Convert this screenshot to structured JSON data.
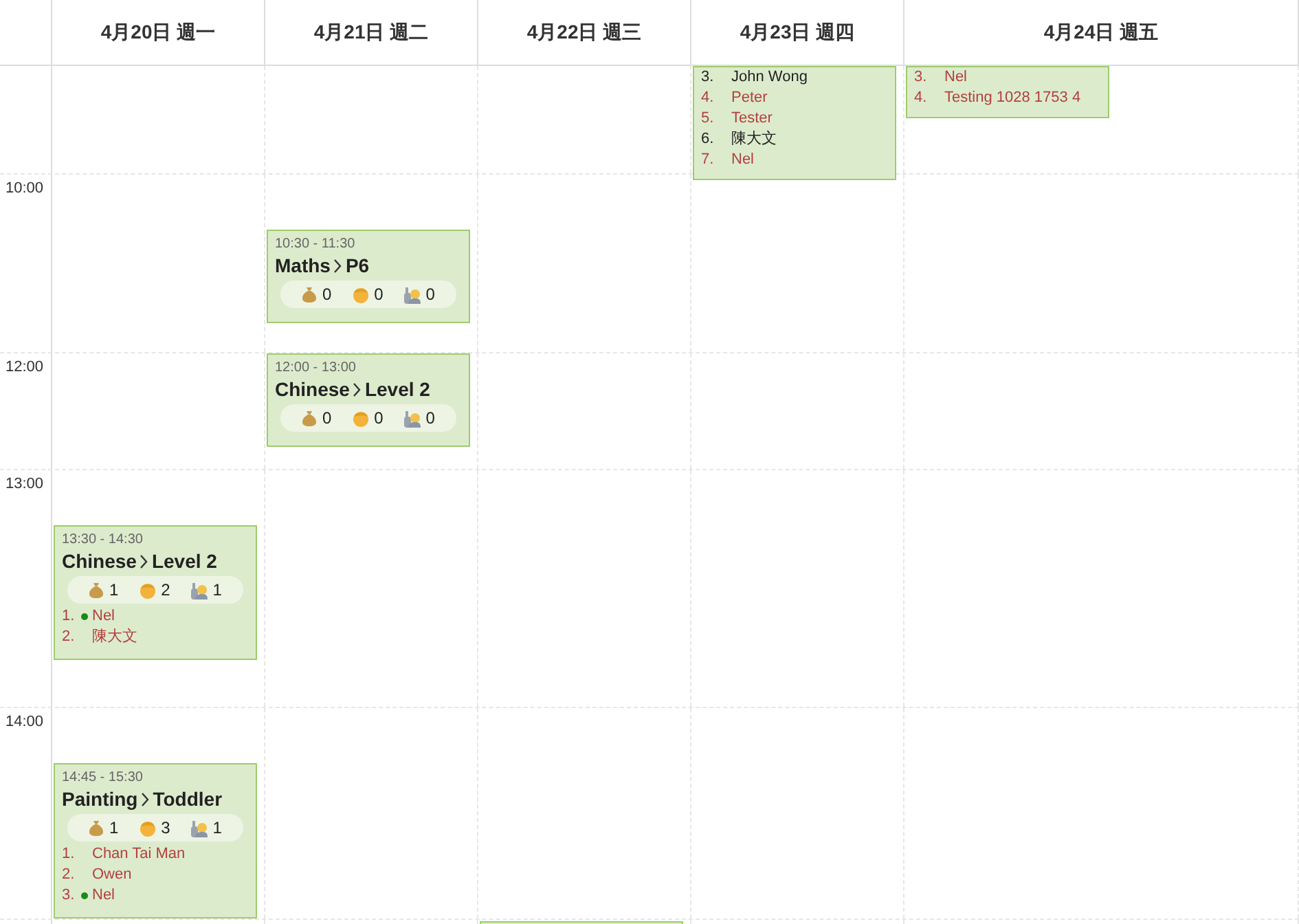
{
  "days": [
    {
      "label": "4月20日 週一"
    },
    {
      "label": "4月21日 週二"
    },
    {
      "label": "4月22日 週三"
    },
    {
      "label": "4月23日 週四"
    },
    {
      "label": "4月24日 週五"
    }
  ],
  "time_labels": [
    "10:00",
    "12:00",
    "13:00",
    "14:00"
  ],
  "events": [
    {
      "kind": "card",
      "items": [
        {
          "number": "3.",
          "name": "John Wong",
          "late": false,
          "checked_in": false
        },
        {
          "number": "4.",
          "name": "Peter",
          "late": true,
          "checked_in": false
        },
        {
          "number": "5.",
          "name": "Tester",
          "late": true,
          "checked_in": false
        },
        {
          "number": "6.",
          "name": "陳大文",
          "late": false,
          "checked_in": false
        },
        {
          "number": "7.",
          "name": "Nel",
          "late": true,
          "checked_in": false
        }
      ]
    },
    {
      "kind": "card",
      "items": [
        {
          "number": "3.",
          "name": "Nel",
          "late": true,
          "checked_in": false
        },
        {
          "number": "4.",
          "name": "Testing 1028 1753 4",
          "late": true,
          "checked_in": false
        }
      ]
    },
    {
      "kind": "card",
      "time": "10:30 - 11:30",
      "subject": "Maths",
      "level": "P6",
      "stats": {
        "payments": "0",
        "students": "0",
        "requests": "0"
      }
    },
    {
      "kind": "card",
      "time": "12:00 - 13:00",
      "subject": "Chinese",
      "level": "Level 2",
      "stats": {
        "payments": "0",
        "students": "0",
        "requests": "0"
      }
    },
    {
      "kind": "card",
      "time": "13:30 - 14:30",
      "subject": "Chinese",
      "level": "Level 2",
      "stats": {
        "payments": "1",
        "students": "2",
        "requests": "1"
      },
      "items": [
        {
          "number": "1.",
          "name": "Nel",
          "late": true,
          "checked_in": true
        },
        {
          "number": "2.",
          "name": "陳大文",
          "late": true,
          "checked_in": false
        }
      ]
    },
    {
      "kind": "card",
      "time": "14:45 - 15:30",
      "subject": "Painting",
      "level": "Toddler",
      "stats": {
        "payments": "1",
        "students": "3",
        "requests": "1"
      },
      "items": [
        {
          "number": "1.",
          "name": "Chan Tai Man",
          "late": true,
          "checked_in": false
        },
        {
          "number": "2.",
          "name": "Owen",
          "late": true,
          "checked_in": false
        },
        {
          "number": "3.",
          "name": "Nel",
          "late": true,
          "checked_in": true
        }
      ]
    },
    {
      "kind": "placeholder"
    }
  ]
}
